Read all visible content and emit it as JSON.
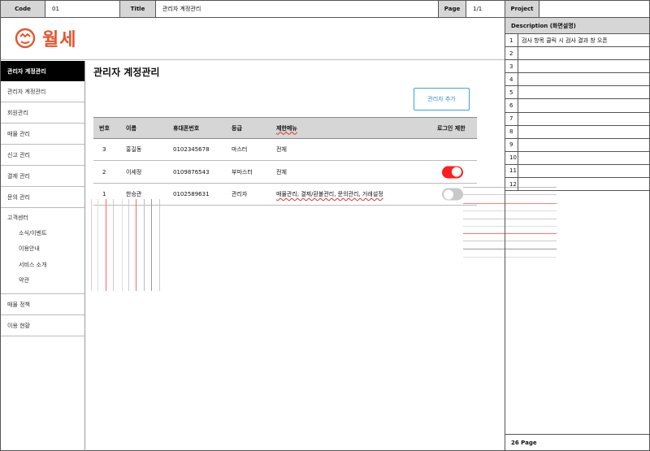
{
  "header": {
    "code_label": "Code",
    "code_value": "01",
    "title_label": "Title",
    "title_value": "관리자 계정관리",
    "page_label": "Page",
    "page_value": "1/1",
    "project_label": "Project",
    "project_value": ""
  },
  "logo": {
    "text": "월세",
    "brand_color": "#e4572e"
  },
  "sidebar": {
    "active": "관리자 계정관리",
    "items_top": [
      "관리자 계정관리",
      "회원관리",
      "매물 관리",
      "신고 관리",
      "결제 관리",
      "문의 관리"
    ],
    "group": {
      "title": "고객센터",
      "subs": [
        "소식/이벤트",
        "이용안내",
        "서비스 소개",
        "약관"
      ]
    },
    "items_bottom": [
      "매물 정책",
      "이용 현황"
    ]
  },
  "main": {
    "title": "관리자 계정관리",
    "add_button": "관리자 추가",
    "table": {
      "headers": [
        "번호",
        "이름",
        "휴대폰번호",
        "등급",
        "제한메뉴",
        "로그인 제한"
      ],
      "rows": [
        {
          "no": "3",
          "name": "홍길동",
          "phone": "0102345678",
          "grade": "마스터",
          "menu": "전체",
          "login_restricted": null
        },
        {
          "no": "2",
          "name": "이세정",
          "phone": "0109876543",
          "grade": "부마스터",
          "menu": "전체",
          "login_restricted": true
        },
        {
          "no": "1",
          "name": "한승관",
          "phone": "0102589631",
          "grade": "관리자",
          "menu": "매물관리, 결제/환불관리, 문의관리, 거래설정",
          "login_restricted": false
        }
      ]
    }
  },
  "description": {
    "title": "Description (화면설명)",
    "rows": [
      {
        "n": "1",
        "text": "검사 항목 클릭 시 검사 결과 창 오픈"
      },
      {
        "n": "2",
        "text": ""
      },
      {
        "n": "3",
        "text": ""
      },
      {
        "n": "4",
        "text": ""
      },
      {
        "n": "5",
        "text": ""
      },
      {
        "n": "6",
        "text": ""
      },
      {
        "n": "7",
        "text": ""
      },
      {
        "n": "8",
        "text": ""
      },
      {
        "n": "9",
        "text": ""
      },
      {
        "n": "10",
        "text": ""
      },
      {
        "n": "11",
        "text": ""
      },
      {
        "n": "12",
        "text": ""
      }
    ],
    "footer": "26 Page"
  },
  "colors": {
    "toggle_on": "#ff1d1d",
    "toggle_off": "#c8c8c8",
    "button_border": "#3aa0e6"
  }
}
